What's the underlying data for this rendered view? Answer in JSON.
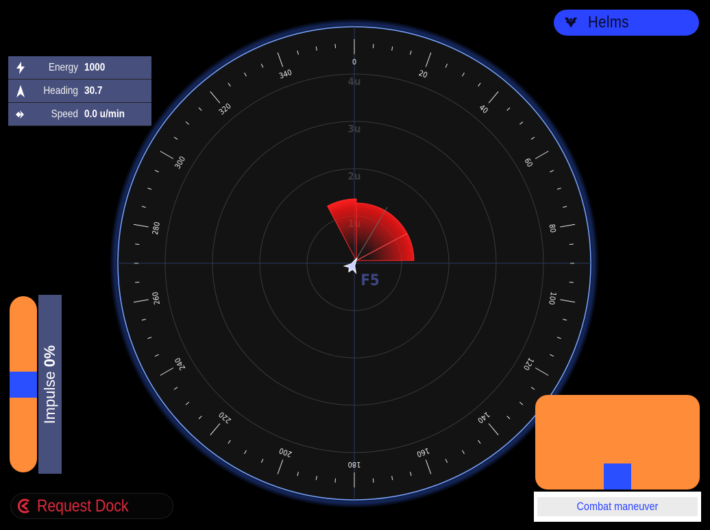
{
  "station": {
    "label": "Helms",
    "icon": "ship-emblem-icon"
  },
  "stats": [
    {
      "icon": "lightning-icon",
      "label": "Energy",
      "value": "1000"
    },
    {
      "icon": "heading-arrow-icon",
      "label": "Heading",
      "value": "30.7"
    },
    {
      "icon": "speed-chevron-icon",
      "label": "Speed",
      "value": "0.0 u/min"
    }
  ],
  "impulse": {
    "label": "Impulse",
    "value": "0%",
    "level": 0
  },
  "dock": {
    "label": "Request Dock",
    "icon": "dock-icon"
  },
  "combat": {
    "label": "Combat maneuver"
  },
  "radar": {
    "heading_deg": 30.7,
    "sector": "F5",
    "range_labels": [
      "1u",
      "2u",
      "3u",
      "4u"
    ],
    "bearing_labels": [
      "0",
      "20",
      "40",
      "60",
      "80",
      "100",
      "120",
      "140",
      "160",
      "180",
      "200",
      "220",
      "240",
      "260",
      "280",
      "300",
      "320",
      "340"
    ]
  },
  "colors": {
    "accent_blue": "#2a44ff",
    "accent_orange": "#ff8c38",
    "panel": "#474f7d",
    "danger_red": "#e0283c"
  }
}
